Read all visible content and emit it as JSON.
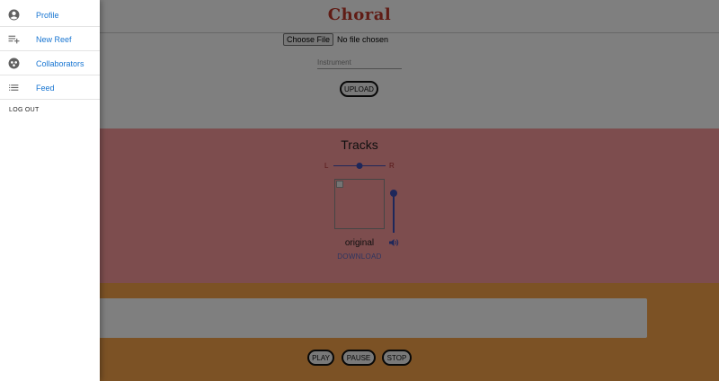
{
  "app": {
    "title": "Choral"
  },
  "upload": {
    "choose_file_label": "Choose File",
    "file_status": "No file chosen",
    "instrument_placeholder": "Instrument",
    "upload_label": "UPLOAD"
  },
  "tracks": {
    "title": "Tracks",
    "pan": {
      "left_label": "L",
      "right_label": "R",
      "value": 0.5
    },
    "items": [
      {
        "name": "original",
        "download_label": "DOWNLOAD",
        "volume": 1.0
      }
    ]
  },
  "player": {
    "play_label": "PLAY",
    "pause_label": "PAUSE",
    "stop_label": "STOP"
  },
  "drawer": {
    "items": [
      {
        "label": "Profile",
        "icon": "account-circle-icon"
      },
      {
        "label": "New Reef",
        "icon": "playlist-add-icon"
      },
      {
        "label": "Collaborators",
        "icon": "group-icon"
      },
      {
        "label": "Feed",
        "icon": "list-icon"
      }
    ],
    "logout_label": "LOG OUT"
  },
  "colors": {
    "brand": "#c0392b",
    "tracks_bg": "#fb9a9d",
    "player_bg": "#f9a54a",
    "accent": "#3c4fb5",
    "link": "#1976d2"
  }
}
